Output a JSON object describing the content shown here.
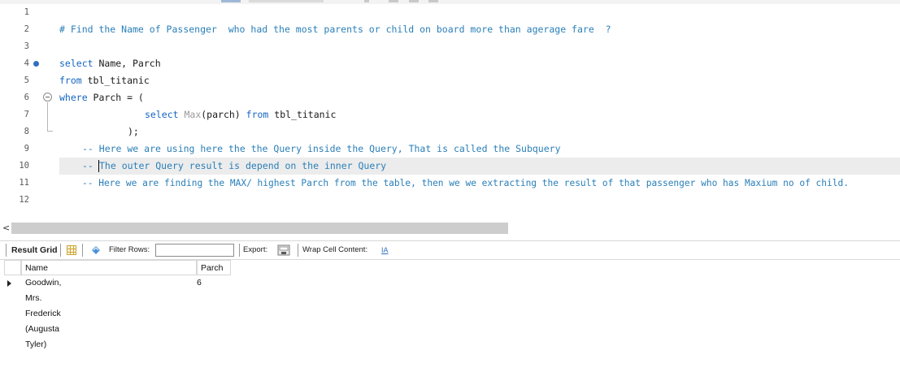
{
  "editor": {
    "lines": [
      {
        "num": "1",
        "text": ""
      },
      {
        "num": "2",
        "text": "# Find the Name of Passenger  who had the most parents or child on board more than agerage fare  ?"
      },
      {
        "num": "3",
        "text": ""
      },
      {
        "num": "4",
        "kw1": "select",
        "rest": " Name, Parch"
      },
      {
        "num": "5",
        "kw1": "from",
        "rest": " tbl_titanic"
      },
      {
        "num": "6",
        "kw1": "where",
        "rest": " Parch = ("
      },
      {
        "num": "7",
        "kw1": "select",
        "fn": " Max",
        "mid": "(parch) ",
        "kw2": "from",
        "rest": " tbl_titanic"
      },
      {
        "num": "8",
        "rest": ");"
      },
      {
        "num": "9",
        "text": "-- Here we are using here the the Query inside the Query, That is called the Subquery"
      },
      {
        "num": "10",
        "dashes": "-- ",
        "text": "The outer Query result is depend on the inner Query"
      },
      {
        "num": "11",
        "text": "-- Here we are finding the MAX/ highest Parch from the table, then we we extracting the result of that passenger who has Maxium no of child."
      },
      {
        "num": "12",
        "text": ""
      }
    ]
  },
  "scrollbar": {
    "left_arrow": "<"
  },
  "result_toolbar": {
    "result_grid_label": "Result Grid",
    "filter_rows_label": "Filter Rows:",
    "filter_value": "",
    "export_label": "Export:",
    "wrap_label": "Wrap Cell Content:",
    "wrap_icon": "IA"
  },
  "result_grid": {
    "columns": [
      "Name",
      "Parch"
    ],
    "rows": [
      [
        "Goodwin, Mrs. Frederick (Augusta Tyler)",
        "6"
      ]
    ]
  },
  "colors": {
    "keyword": "#1565c0",
    "comment": "#2a7fb8",
    "function": "#9a9a9a",
    "breakpoint": "#2f6fc1"
  },
  "icons": [
    "breakpoint-marker-icon",
    "fold-icon",
    "scroll-left-icon",
    "grid-icon",
    "filter-icon",
    "export-icon",
    "wrap-cell-icon",
    "current-row-arrow-icon"
  ]
}
